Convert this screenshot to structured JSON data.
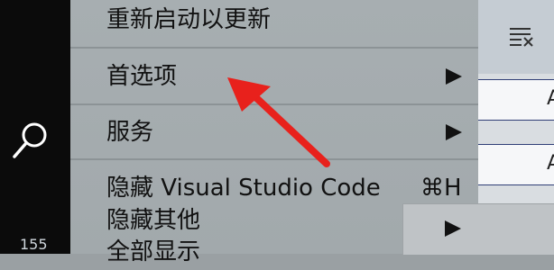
{
  "menu": {
    "items": [
      {
        "label": "重新启动以更新"
      },
      {
        "label": "首选项"
      },
      {
        "label": "服务"
      },
      {
        "label": "隐藏 Visual Studio Code",
        "shortcut": "⌘H"
      },
      {
        "label": "隐藏其他"
      },
      {
        "label": "全部显示"
      }
    ]
  },
  "activity_bar": {
    "badge": "155"
  },
  "right_panel": {
    "cell_letters": [
      "A",
      "A",
      "A"
    ]
  },
  "colors": {
    "annotation_arrow": "#e8211c",
    "menu_bg": "#a5acaf"
  }
}
